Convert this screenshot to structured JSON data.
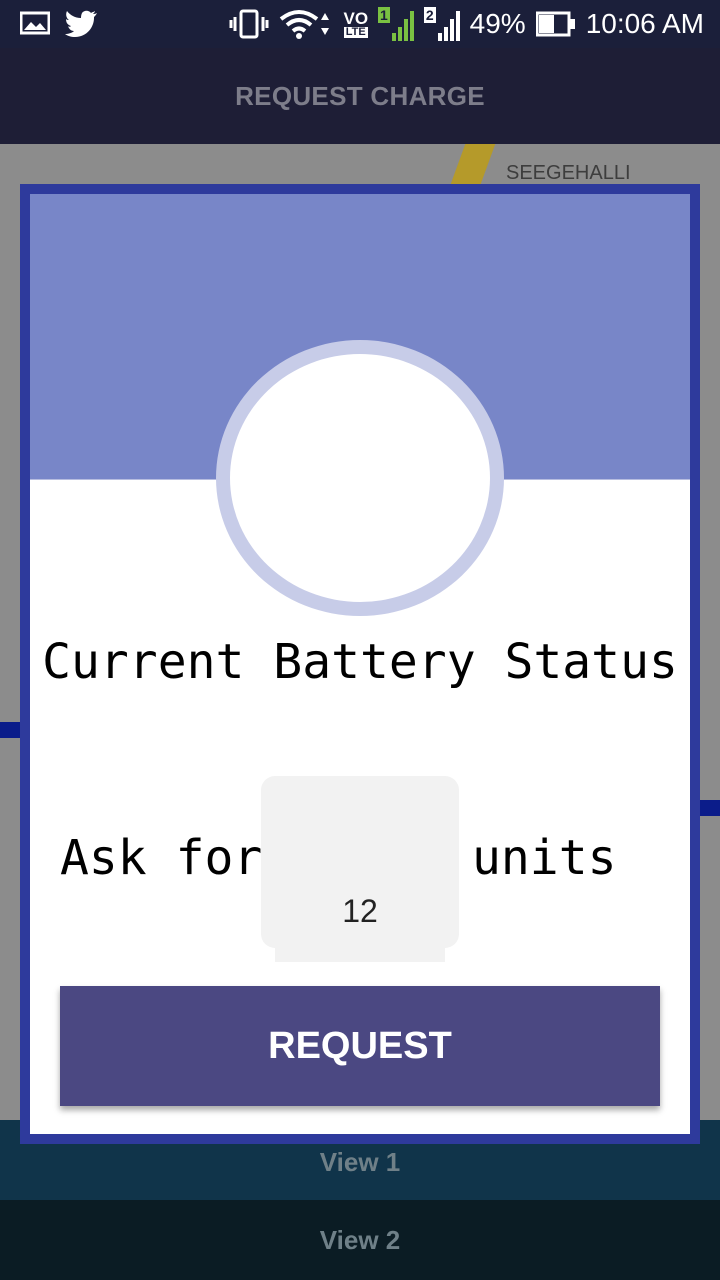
{
  "status_bar": {
    "battery_percent": "49%",
    "time": "10:06 AM",
    "sim1_label": "1",
    "sim2_label": "2",
    "volte_label": "VO",
    "lte_label": "LTE"
  },
  "app_bar": {
    "title": "REQUEST CHARGE"
  },
  "map": {
    "place_label": "SEEGEHALLI"
  },
  "dialog": {
    "battery_status_title": "Current Battery Status",
    "ask_prefix": "Ask for",
    "units_value": "12",
    "units_suffix": "units",
    "request_button_label": "REQUEST"
  },
  "bottom_nav": {
    "view1_label": "View 1",
    "view2_label": "View 2"
  },
  "colors": {
    "dialog_border": "#2e3a9c",
    "dialog_header": "#7886c8",
    "circle_ring": "#c7cce8",
    "request_button": "#4b4882",
    "app_bar": "#1e1e36"
  }
}
